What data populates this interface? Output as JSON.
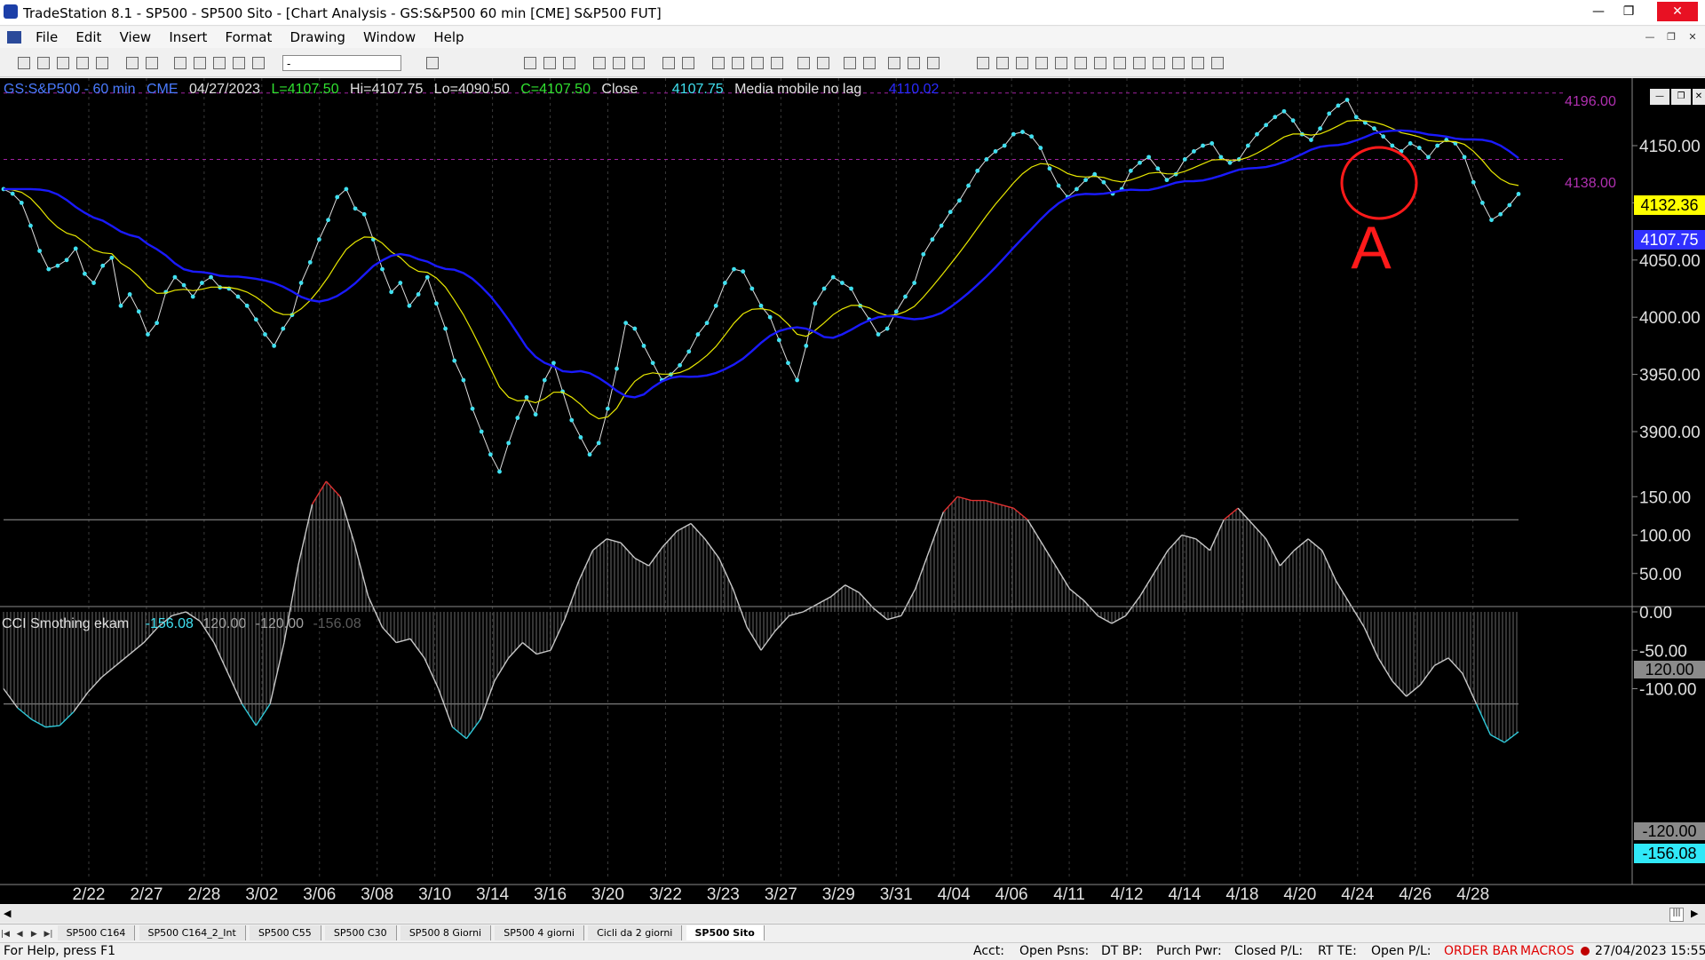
{
  "window": {
    "title": "TradeStation 8.1 - SP500 - SP500 Sito - [Chart Analysis - GS:S&P500  60 min  [CME] S&P500 FUT]",
    "min": "—",
    "max": "❐",
    "close": "✕"
  },
  "menu": [
    "File",
    "Edit",
    "View",
    "Insert",
    "Format",
    "Drawing",
    "Window",
    "Help"
  ],
  "toolbar": {
    "symbol_value": "-"
  },
  "price_legend": {
    "symbol": "GS:S&P500 - 60 min",
    "exchange": "CME",
    "date": "04/27/2023",
    "last": "L=4107.50",
    "hi": "Hi=4107.75",
    "lo": "Lo=4090.50",
    "close_eq": "C=4107.50",
    "close_label": "Close",
    "close_value": "4107.75",
    "ma_label": "Media mobile no lag",
    "ma_value": "4110.02"
  },
  "cci_legend": {
    "name": "CCI Smothing ekam",
    "v1": "-156.08",
    "v2": "120.00",
    "v3": "-120.00",
    "v4": "-156.08"
  },
  "price_levels": {
    "upper": "4196.00",
    "lower": "4138.00"
  },
  "price_tags": {
    "yellow": "4132.36",
    "blue": "4107.75"
  },
  "cci_tags": {
    "upper": "120.00",
    "lower": "-120.00",
    "current": "-156.08"
  },
  "annotation": {
    "letter": "A"
  },
  "tabs": [
    "SP500 C164",
    "SP500 C164_2_Int",
    "SP500 C55",
    "SP500 C30",
    "SP500 8 Giorni",
    "SP500 4 giorni",
    "Cicli da 2 giorni",
    "SP500 Sito"
  ],
  "active_tab": "SP500 Sito",
  "status": {
    "help": "For Help, press F1",
    "acct": "Acct:",
    "open_psns": "Open Psns:",
    "dt_bp": "DT BP:",
    "purch_pwr": "Purch Pwr:",
    "closed_pl": "Closed P/L:",
    "rt_te": "RT TE:",
    "open_pl": "Open P/L:",
    "order_bar": "ORDER BAR",
    "macros": "MACROS",
    "datetime": "27/04/2023 15:55"
  },
  "colors": {
    "price_line": "#e0e0e0",
    "price_dot": "#40e0f0",
    "fast_ma": "#e8e800",
    "slow_ma": "#1a1aff",
    "cci_line": "#c8c8c8",
    "cci_high": "#e03030",
    "cci_low": "#30c8d8",
    "annotation": "#ff1a1a"
  },
  "chart_data": [
    {
      "type": "line",
      "title": "GS:S&P500 - 60 min",
      "x_ticks": [
        "2/22",
        "2/27",
        "2/28",
        "3/02",
        "3/06",
        "3/08",
        "3/10",
        "3/14",
        "3/16",
        "3/20",
        "3/22",
        "3/23",
        "3/27",
        "3/29",
        "3/31",
        "4/04",
        "4/06",
        "4/11",
        "4/12",
        "4/14",
        "4/18",
        "4/20",
        "4/24",
        "4/26",
        "4/28"
      ],
      "y_ticks": [
        3900,
        3950,
        4000,
        4050,
        4100,
        4150
      ],
      "ylim": [
        3850,
        4200
      ],
      "series": [
        {
          "name": "Close",
          "values": [
            4112,
            4108,
            4100,
            4080,
            4058,
            4042,
            4045,
            4050,
            4060,
            4038,
            4030,
            4045,
            4052,
            4010,
            4020,
            4005,
            3985,
            3995,
            4022,
            4035,
            4028,
            4018,
            4030,
            4035,
            4026,
            4025,
            4018,
            4010,
            3998,
            3985,
            3975,
            3990,
            4002,
            4030,
            4048,
            4068,
            4085,
            4105,
            4112,
            4095,
            4090,
            4068,
            4042,
            4022,
            4030,
            4010,
            4020,
            4035,
            4012,
            3990,
            3962,
            3945,
            3920,
            3900,
            3880,
            3865,
            3890,
            3912,
            3930,
            3915,
            3945,
            3960,
            3935,
            3910,
            3895,
            3880,
            3890,
            3920,
            3955,
            3995,
            3990,
            3975,
            3960,
            3945,
            3950,
            3958,
            3970,
            3985,
            3995,
            4010,
            4030,
            4042,
            4040,
            4025,
            4010,
            4000,
            3980,
            3960,
            3945,
            3975,
            4012,
            4025,
            4035,
            4030,
            4025,
            4010,
            3998,
            3985,
            3990,
            4005,
            4018,
            4030,
            4055,
            4068,
            4080,
            4092,
            4102,
            4115,
            4128,
            4138,
            4145,
            4150,
            4160,
            4162,
            4158,
            4148,
            4130,
            4115,
            4105,
            4112,
            4120,
            4125,
            4118,
            4108,
            4112,
            4128,
            4135,
            4140,
            4130,
            4120,
            4125,
            4138,
            4145,
            4150,
            4152,
            4140,
            4135,
            4138,
            4150,
            4160,
            4168,
            4175,
            4180,
            4172,
            4160,
            4155,
            4165,
            4178,
            4185,
            4190,
            4175,
            4170,
            4165,
            4158,
            4150,
            4145,
            4152,
            4148,
            4140,
            4150,
            4155,
            4152,
            4140,
            4118,
            4100,
            4085,
            4090,
            4098,
            4107.75
          ]
        },
        {
          "name": "Media mobile no lag",
          "values": [
            4110.02
          ]
        }
      ],
      "annotations": [
        "4196.00",
        "4138.00",
        "A"
      ]
    },
    {
      "type": "area",
      "title": "CCI Smothing ekam",
      "y_ticks": [
        -100,
        -50,
        0,
        50,
        100,
        150
      ],
      "ylim": [
        -180,
        180
      ],
      "series": [
        {
          "name": "CCI Smothing ekam",
          "values": [
            -100,
            -125,
            -140,
            -150,
            -148,
            -130,
            -105,
            -85,
            -70,
            -55,
            -40,
            -20,
            -5,
            0,
            -12,
            -40,
            -80,
            -120,
            -148,
            -120,
            -40,
            60,
            140,
            170,
            150,
            90,
            20,
            -20,
            -40,
            -35,
            -60,
            -100,
            -150,
            -165,
            -140,
            -90,
            -60,
            -40,
            -55,
            -50,
            -10,
            40,
            80,
            95,
            90,
            70,
            60,
            85,
            105,
            115,
            95,
            70,
            30,
            -20,
            -50,
            -25,
            -5,
            0,
            10,
            20,
            35,
            25,
            5,
            -10,
            -5,
            30,
            80,
            130,
            150,
            145,
            145,
            140,
            135,
            120,
            90,
            60,
            30,
            15,
            -5,
            -15,
            -5,
            20,
            50,
            80,
            100,
            95,
            80,
            120,
            135,
            115,
            95,
            60,
            80,
            95,
            80,
            40,
            10,
            -20,
            -60,
            -90,
            -110,
            -95,
            -70,
            -60,
            -80,
            -120,
            -160,
            -170,
            -156.08
          ]
        }
      ],
      "annotations": [
        "120.00",
        "-120.00"
      ]
    }
  ]
}
